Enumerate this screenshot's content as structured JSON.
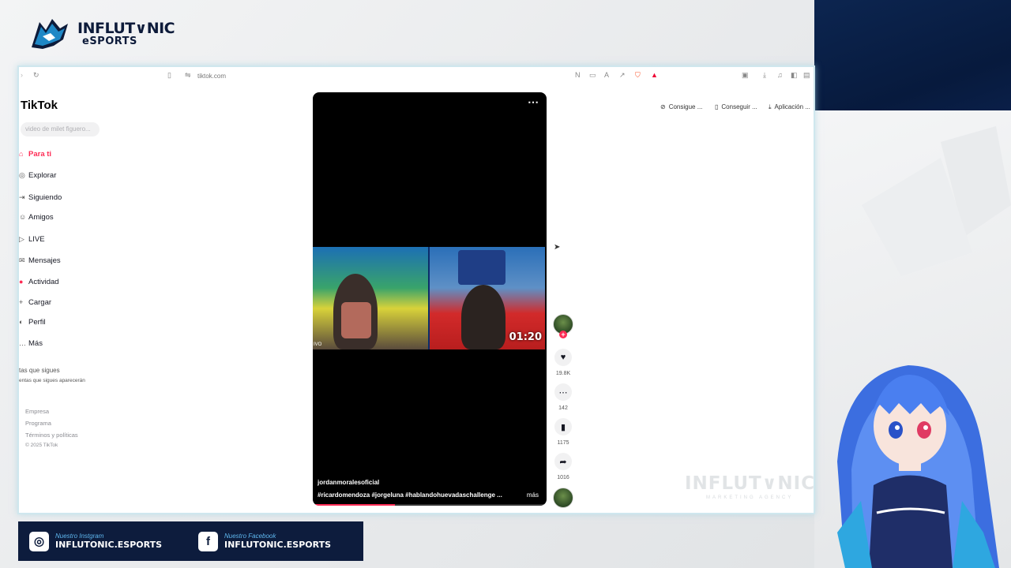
{
  "overlay": {
    "brand_line1": "INFLUT∨NIC",
    "brand_line2": "eSPORTS",
    "watermark": "INFLUT∨NIC",
    "watermark_sub": "MARKETING AGENCY",
    "social": [
      {
        "icon": "instagram-icon",
        "label": "Nuestro Instgram",
        "handle": "INFLUTONIC.ESPORTS"
      },
      {
        "icon": "facebook-icon",
        "label": "Nuestro Facebook",
        "handle": "INFLUTONIC.ESPORTS"
      }
    ]
  },
  "browser": {
    "url": "tiktok.com"
  },
  "tiktok": {
    "logo": "TikTok",
    "search_placeholder": "video de milet figuero...",
    "nav": [
      {
        "label": "Para ti",
        "icon": "home-icon",
        "active": true
      },
      {
        "label": "Explorar",
        "icon": "compass-icon",
        "active": false
      },
      {
        "label": "Siguiendo",
        "icon": "following-icon",
        "active": false
      },
      {
        "label": "Amigos",
        "icon": "friends-icon",
        "active": false
      },
      {
        "label": "LIVE",
        "icon": "live-icon",
        "active": false
      },
      {
        "label": "Mensajes",
        "icon": "message-icon",
        "active": false
      },
      {
        "label": "Actividad",
        "icon": "activity-icon",
        "active": false
      },
      {
        "label": "Cargar",
        "icon": "upload-icon",
        "active": false
      },
      {
        "label": "Perfil",
        "icon": "profile-icon",
        "active": false
      },
      {
        "label": "Más",
        "icon": "more-icon",
        "active": false
      }
    ],
    "following_title": "tas que sigues",
    "following_note": "entas que sigues aparecerán",
    "footer": [
      "Empresa",
      "Programa",
      "Términos y políticas",
      "© 2025 TikTok"
    ],
    "actions": [
      "Consigue ...",
      "Conseguir ...",
      "Aplicación ..."
    ],
    "video": {
      "timer": "01:20",
      "live_tag": "IVO",
      "author": "jordanmoralesoficial",
      "tags": "#ricardomendoza #jorgeluna #hablandohuevadaschallenge ...",
      "more": "más",
      "progress": 0.35
    },
    "stats": {
      "likes": "19.8K",
      "comments": "142",
      "saves": "1175",
      "shares": "1016"
    }
  },
  "colors": {
    "accent": "#fe2c55",
    "overlay_navy": "#0d1c3d"
  }
}
